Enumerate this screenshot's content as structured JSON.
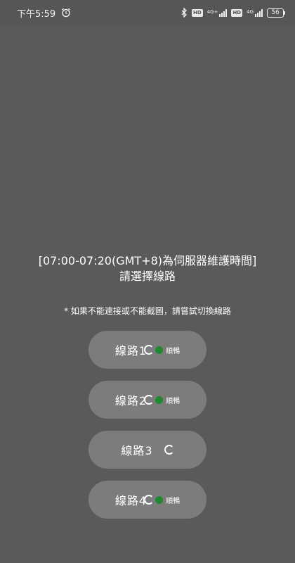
{
  "status_bar": {
    "time": "下午5:59",
    "hd1": "HD",
    "net1": "4G+",
    "hd2": "HD",
    "net2": "4G",
    "battery": "56"
  },
  "notice": {
    "line1": "[07:00-07:20(GMT+8)為伺服器維護時間]",
    "line2": "請選擇線路"
  },
  "tip": "* 如果不能連接或不能截圖，請嘗試切換線路",
  "routes": [
    {
      "label": "線路1",
      "status": "順暢"
    },
    {
      "label": "線路2",
      "status": "順暢"
    },
    {
      "label": "線路3",
      "status": ""
    },
    {
      "label": "線路4",
      "status": "順暢"
    }
  ],
  "colors": {
    "background": "#5a5a5a",
    "button": "#7c7c7c",
    "status_ok": "#1e8a2c"
  }
}
